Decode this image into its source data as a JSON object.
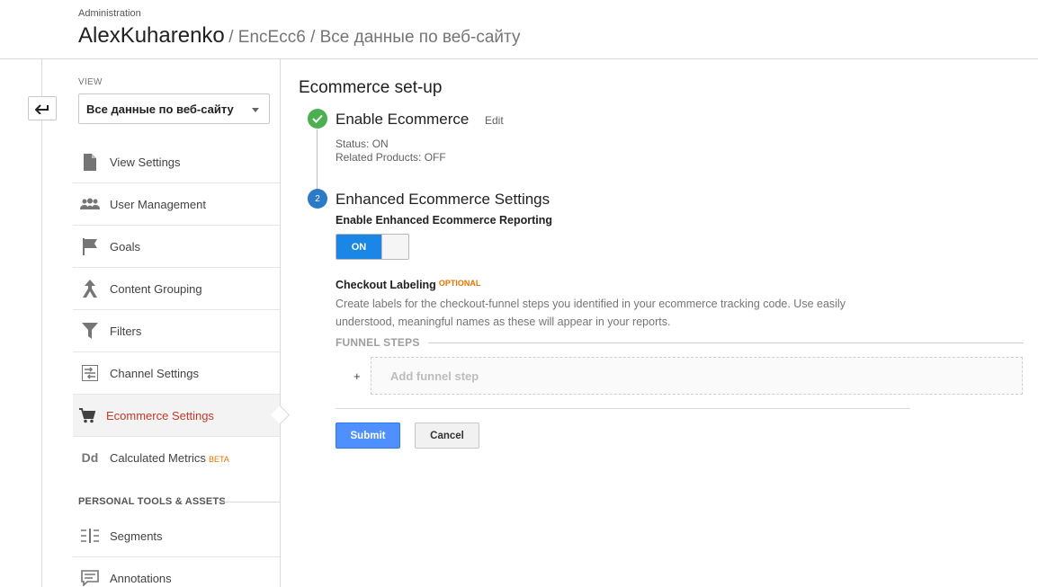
{
  "header": {
    "admin_label": "Administration",
    "account": "AlexKuharenko",
    "separator": "/",
    "property": "EncEcc6",
    "view": "Все данные по веб-сайту"
  },
  "sidebar": {
    "view_label": "VIEW",
    "view_select": "Все данные по веб-сайту",
    "items": [
      {
        "label": "View Settings",
        "icon": "document-icon"
      },
      {
        "label": "User Management",
        "icon": "people-icon"
      },
      {
        "label": "Goals",
        "icon": "flag-icon"
      },
      {
        "label": "Content Grouping",
        "icon": "content-grouping-icon"
      },
      {
        "label": "Filters",
        "icon": "filter-icon"
      },
      {
        "label": "Channel Settings",
        "icon": "channel-settings-icon"
      },
      {
        "label": "Ecommerce Settings",
        "icon": "cart-icon",
        "active": true
      },
      {
        "label": "Calculated Metrics",
        "icon": "dd-icon",
        "badge": "BETA"
      }
    ],
    "section_label": "PERSONAL TOOLS & ASSETS",
    "tools": [
      {
        "label": "Segments",
        "icon": "segments-icon"
      },
      {
        "label": "Annotations",
        "icon": "annotations-icon"
      }
    ],
    "icon_glyph_dd": "Dd"
  },
  "main": {
    "title": "Ecommerce set-up",
    "step1": {
      "title": "Enable Ecommerce",
      "edit": "Edit",
      "status": "Status: ON",
      "related": "Related Products: OFF"
    },
    "step2": {
      "number": "2",
      "title": "Enhanced Ecommerce Settings",
      "reporting_label": "Enable Enhanced Ecommerce Reporting",
      "toggle_state": "ON"
    },
    "checkout": {
      "title": "Checkout Labeling",
      "optional": "OPTIONAL",
      "description": "Create labels for the checkout-funnel steps you identified in your ecommerce tracking code. Use easily understood, meaningful names as these will appear in your reports.",
      "funnel_label": "FUNNEL STEPS",
      "plus": "+",
      "add_step": "Add funnel step"
    },
    "buttons": {
      "submit": "Submit",
      "cancel": "Cancel"
    }
  },
  "colors": {
    "active_text": "#c53929",
    "toggle_on": "#1a87e6",
    "submit": "#4d90fe",
    "check": "#4caf50",
    "step_number": "#2b7ac7",
    "optional": "#e37400"
  }
}
